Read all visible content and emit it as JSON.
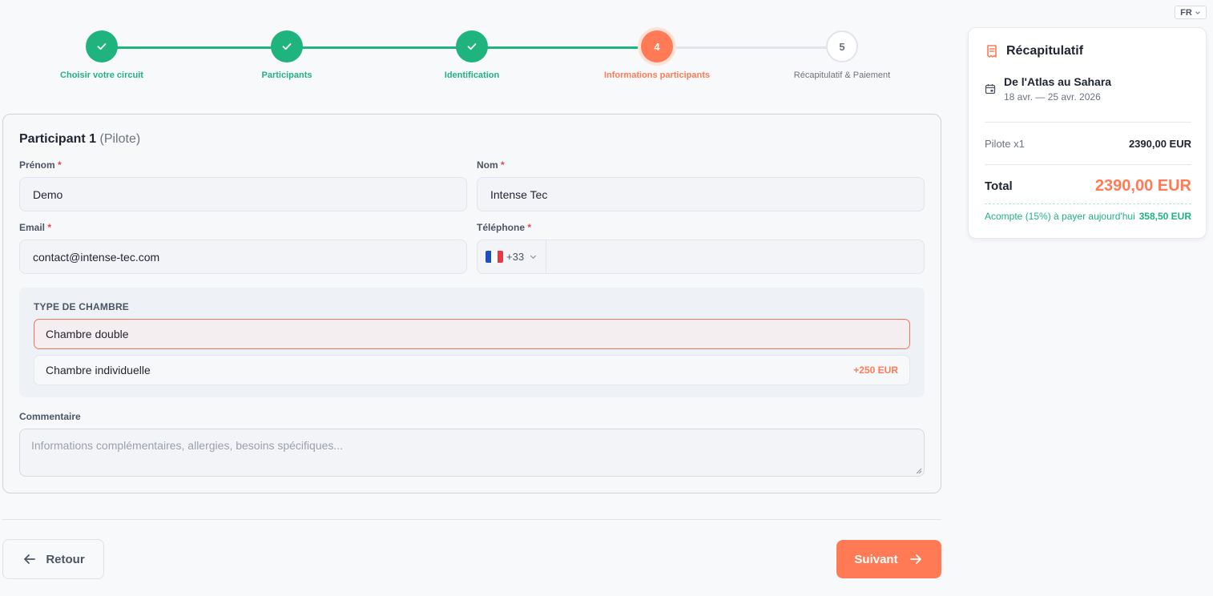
{
  "language": {
    "current": "FR"
  },
  "stepper": {
    "steps": [
      {
        "number": "1",
        "label": "Choisir votre circuit",
        "state": "done"
      },
      {
        "number": "2",
        "label": "Participants",
        "state": "done"
      },
      {
        "number": "3",
        "label": "Identification",
        "state": "done"
      },
      {
        "number": "4",
        "label": "Informations participants",
        "state": "current"
      },
      {
        "number": "5",
        "label": "Récapitulatif & Paiement",
        "state": "todo"
      }
    ]
  },
  "form": {
    "title": "Participant 1",
    "subtitle": "(Pilote)",
    "required_mark": "*",
    "first_name": {
      "label": "Prénom",
      "value": "Demo"
    },
    "last_name": {
      "label": "Nom",
      "value": "Intense Tec"
    },
    "email": {
      "label": "Email",
      "value": "contact@intense-tec.com"
    },
    "phone": {
      "label": "Téléphone",
      "prefix": "+33",
      "value": ""
    },
    "room": {
      "title": "TYPE DE CHAMBRE",
      "options": [
        {
          "label": "Chambre double",
          "price": "",
          "selected": true
        },
        {
          "label": "Chambre individuelle",
          "price": "+250 EUR",
          "selected": false
        }
      ]
    },
    "comment": {
      "label": "Commentaire",
      "placeholder": "Informations complémentaires, allergies, besoins spécifiques..."
    }
  },
  "nav": {
    "back_label": "Retour",
    "next_label": "Suivant"
  },
  "summary": {
    "title": "Récapitulatif",
    "trip_name": "De l'Atlas au Sahara",
    "trip_dates": "18 avr. — 25 avr. 2026",
    "line_label": "Pilote x1",
    "line_value": "2390,00 EUR",
    "total_label": "Total",
    "total_value": "2390,00 EUR",
    "deposit_label": "Acompte (15%) à payer aujourd'hui",
    "deposit_value": "358,50 EUR"
  },
  "colors": {
    "accent": "#ff7a55",
    "success": "#1fb37e",
    "required": "#e5484d"
  }
}
